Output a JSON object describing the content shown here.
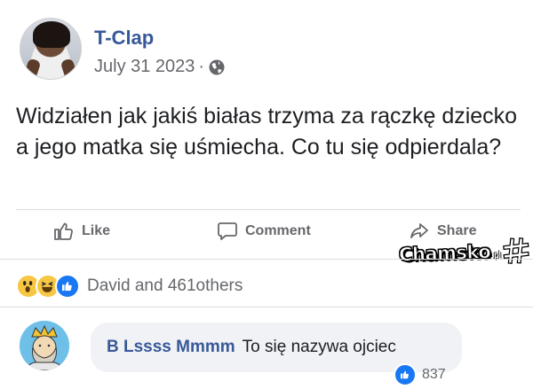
{
  "post": {
    "author": "T-Clap",
    "date": "July 31 2023",
    "separator": "·",
    "privacy_icon": "globe-icon",
    "text": "Widziałen jak jakiś białas trzyma za rączkę dziecko a jego matka się uśmiecha. Co tu się odpierdala?"
  },
  "actions": {
    "like": "Like",
    "comment": "Comment",
    "share": "Share"
  },
  "watermark": {
    "text": "Chamsko",
    "tld": ".pl"
  },
  "reactions": {
    "icons": [
      "wow-icon",
      "haha-icon",
      "like-icon"
    ],
    "summary": "David and 461others"
  },
  "comment": {
    "author": "B Lssss Mmmm",
    "text": "To się nazywa ojciec",
    "like_count": "837"
  },
  "colors": {
    "link_blue": "#385898",
    "like_blue": "#1877f2",
    "muted": "#65676b",
    "bubble": "#f0f2f5"
  }
}
